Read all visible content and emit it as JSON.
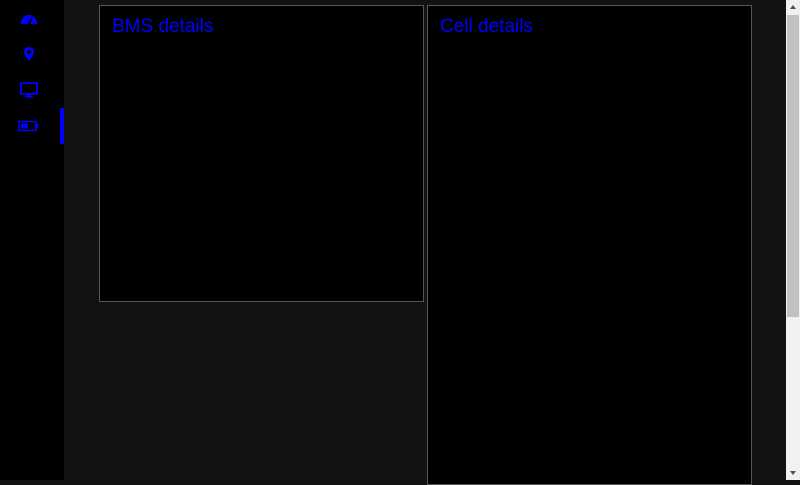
{
  "sidebar": {
    "items": [
      {
        "icon": "gauge-icon",
        "label": ""
      },
      {
        "icon": "map-pin-icon",
        "label": ""
      },
      {
        "icon": "monitor-icon",
        "label": ""
      },
      {
        "icon": "battery-icon",
        "label": "",
        "active": true
      }
    ]
  },
  "panels": {
    "bms": {
      "title": "BMS details"
    },
    "cell": {
      "title": "Cell details"
    }
  },
  "colors": {
    "accent": "#0000ff",
    "background": "#121212",
    "sidebar": "#000000",
    "panel": "#000000",
    "panel_border": "#555555"
  }
}
